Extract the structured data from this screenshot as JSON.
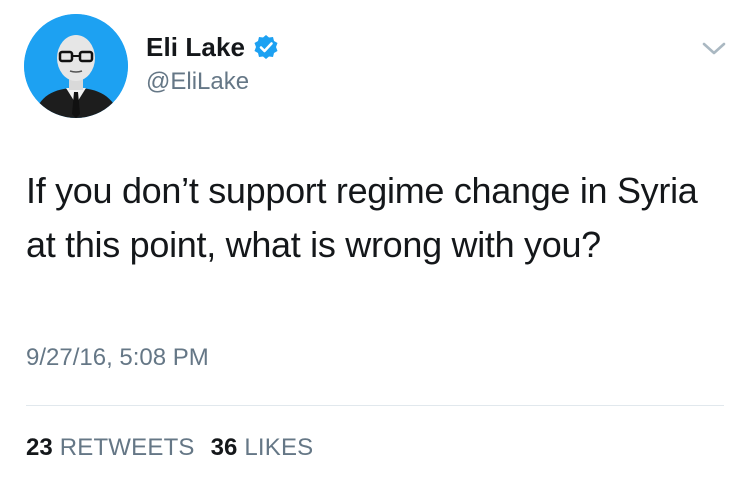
{
  "author": {
    "display_name": "Eli Lake",
    "handle": "@EliLake",
    "verified": true,
    "avatar_icon": "profile-photo"
  },
  "tweet": {
    "text": "If you don’t support regime change in Syria at this point, what is wrong with you?",
    "timestamp": "9/27/16, 5:08 PM",
    "retweets": {
      "count": "23",
      "label": "RETWEETS"
    },
    "likes": {
      "count": "36",
      "label": "LIKES"
    }
  },
  "icons": {
    "verified": "verified-badge-icon",
    "menu": "chevron-down-icon"
  },
  "colors": {
    "primary_text": "#14171a",
    "secondary_text": "#657786",
    "verified_blue": "#1da1f2",
    "divider": "#e1e8ed"
  }
}
